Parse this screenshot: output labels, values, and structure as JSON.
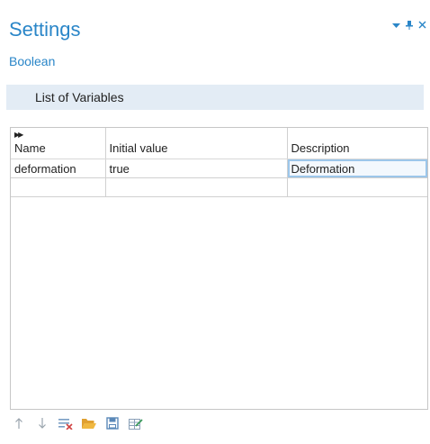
{
  "header": {
    "title": "Settings",
    "subtitle": "Boolean"
  },
  "window_controls": [
    "dropdown-icon",
    "pin-icon",
    "close-icon"
  ],
  "section": {
    "title": "List of Variables"
  },
  "table": {
    "columns": [
      "Name",
      "Initial value",
      "Description"
    ],
    "rows": [
      [
        "deformation",
        "true",
        "Deformation"
      ],
      [
        "",
        "",
        ""
      ]
    ]
  },
  "toolbar": {
    "buttons": [
      "move-up-icon",
      "move-down-icon",
      "delete-icon",
      "load-from-file-icon",
      "save-to-file-icon",
      "edit-table-icon"
    ]
  }
}
